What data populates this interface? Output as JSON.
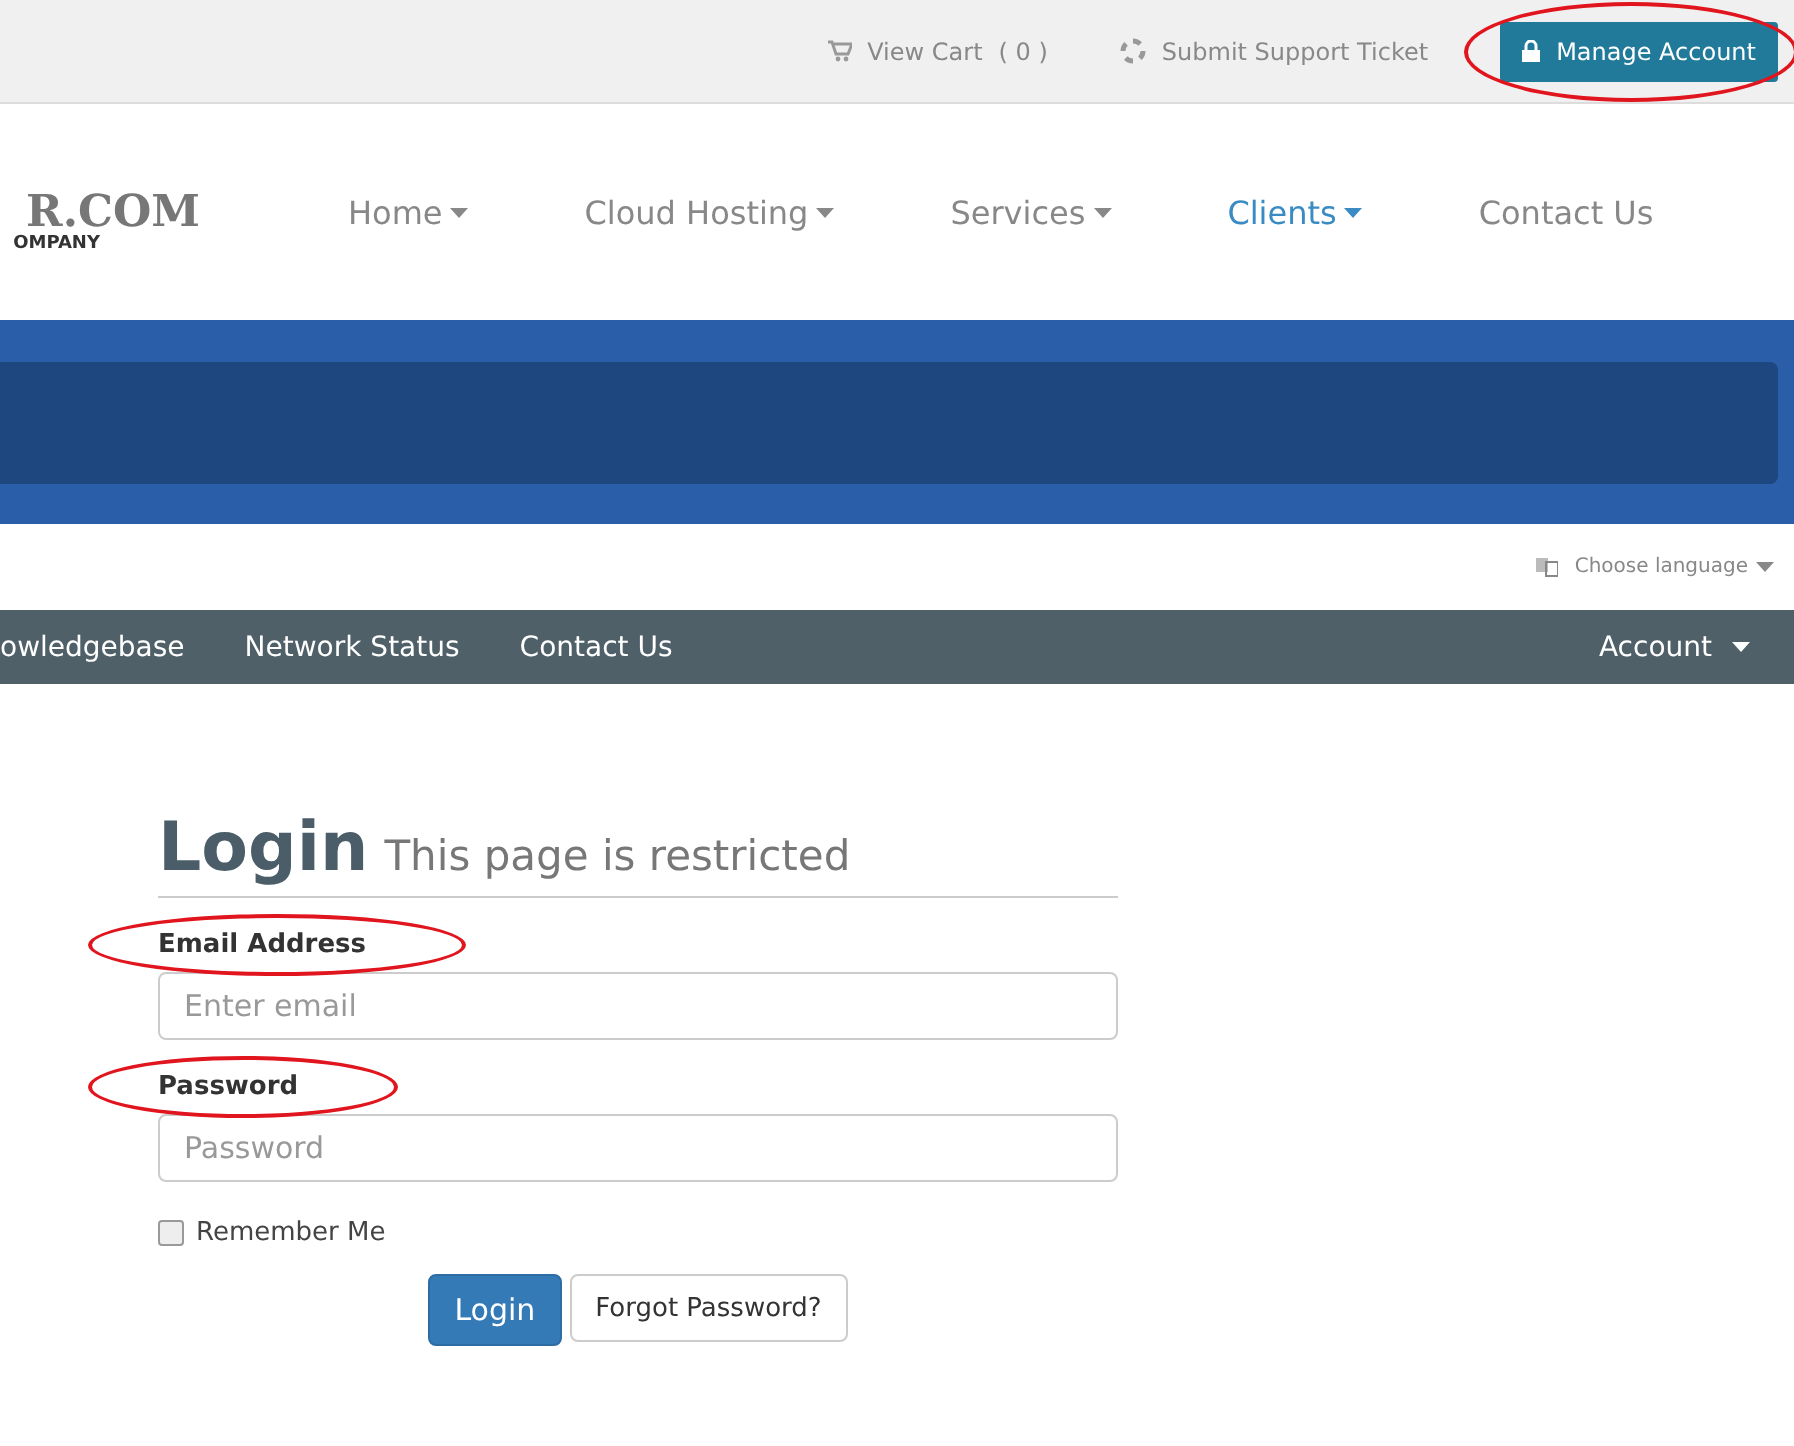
{
  "top_bar": {
    "cart": {
      "label": "View Cart",
      "count": "( 0 )"
    },
    "support": "Submit Support Ticket",
    "account_button": {
      "label": "Manage Account",
      "circled": true
    }
  },
  "logo": {
    "name": "R.COM",
    "tagline": "OMPANY"
  },
  "main_nav": [
    {
      "label": "Home",
      "dropdown": true,
      "selected": false
    },
    {
      "label": "Cloud Hosting",
      "dropdown": true,
      "selected": false
    },
    {
      "label": "Services",
      "dropdown": true,
      "selected": false
    },
    {
      "label": "Clients",
      "dropdown": true,
      "selected": true
    },
    {
      "label": "Contact Us",
      "dropdown": false,
      "selected": false
    }
  ],
  "language": "Choose language",
  "sub_nav": {
    "items": [
      "owledgebase",
      "Network Status",
      "Contact Us"
    ],
    "account": "Account"
  },
  "login": {
    "title": "Login",
    "subtitle": "This page is restricted",
    "fields": [
      {
        "label": "Email Address",
        "placeholder": "Enter email",
        "circled": true
      },
      {
        "label": "Password",
        "placeholder": "Password",
        "circled": true
      }
    ],
    "remember": {
      "label": "Remember Me",
      "checked": false
    },
    "buttons": [
      {
        "label": "Login",
        "kind": "primary"
      },
      {
        "label": "Forgot Password?",
        "kind": "default"
      }
    ]
  }
}
